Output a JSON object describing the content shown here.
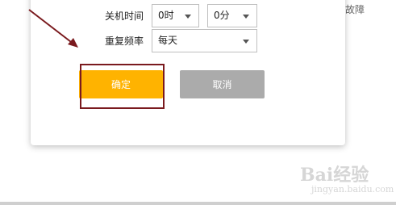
{
  "background": {
    "side_text": "故障",
    "watermark_main": "Bai经验",
    "watermark_sub": "jingyan.baidu.com"
  },
  "form": {
    "shutdown_label": "关机时间",
    "hour_value": "0时",
    "minute_value": "0分",
    "repeat_label": "重复频率",
    "repeat_value": "每天"
  },
  "buttons": {
    "confirm_label": "确定",
    "cancel_label": "取消"
  },
  "colors": {
    "confirm": "#ffb300",
    "cancel": "#ababab",
    "annotation": "#7a1a1e"
  },
  "icons": [
    "chevron-down-icon",
    "annotation-arrow",
    "baidu-paw-icon"
  ]
}
